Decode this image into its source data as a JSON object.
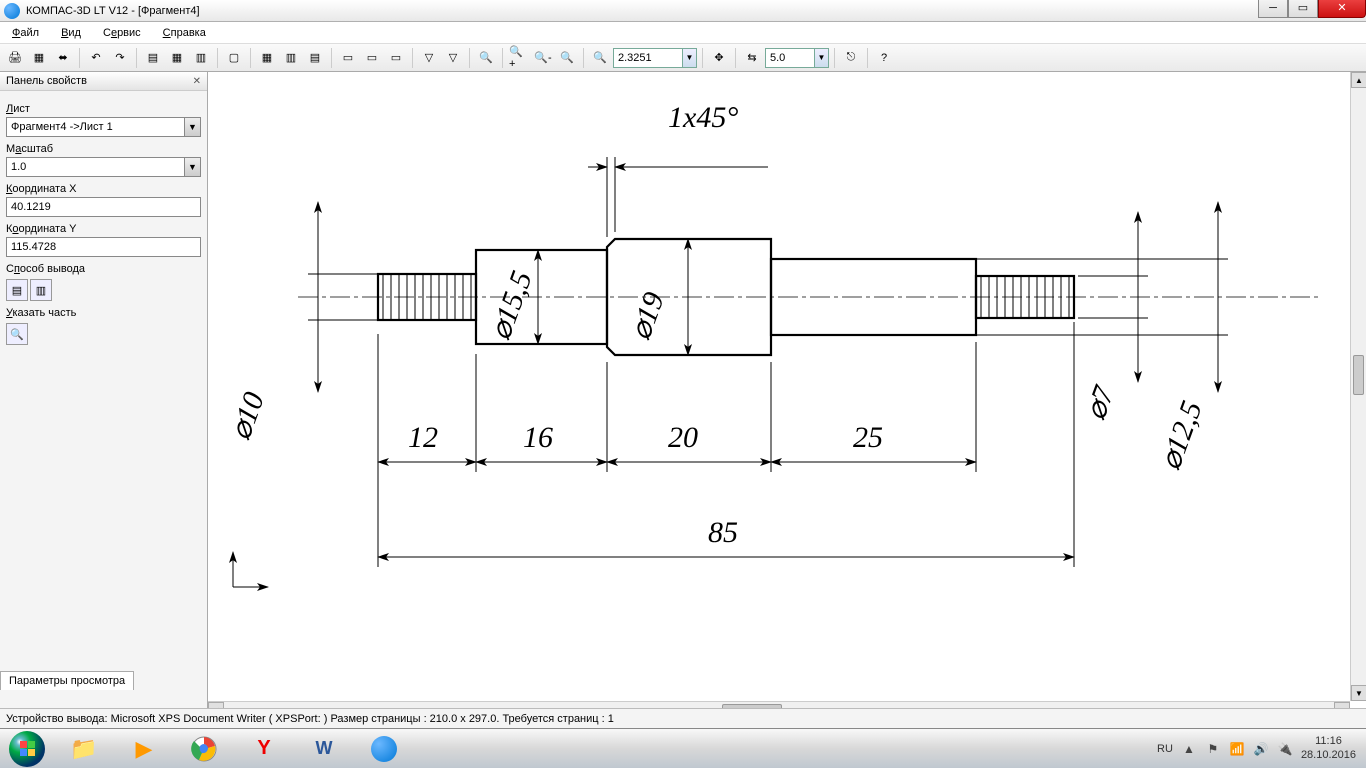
{
  "window": {
    "title": "КОМПАС-3D LT V12 - [Фрагмент4]"
  },
  "menu": {
    "file": "Файл",
    "view": "Вид",
    "service": "Сервис",
    "help": "Справка"
  },
  "toolbar": {
    "zoom_value": "2.3251",
    "step_value": "5.0"
  },
  "panel": {
    "title": "Панель свойств",
    "sheet_label": "Лист",
    "sheet_value": "Фрагмент4 ->Лист 1",
    "scale_label": "Масштаб",
    "scale_value": "1.0",
    "coordX_label": "Координата X",
    "coordX_value": "40.1219",
    "coordY_label": "Координата Y",
    "coordY_value": "115.4728",
    "output_label": "Способ вывода",
    "part_label": "Указать часть",
    "tab": "Параметры просмотра"
  },
  "statusbar": {
    "text": "Устройство вывода: Microsoft XPS Document Writer ( XPSPort: )   Размер страницы : 210.0 x 297.0.   Требуется страниц : 1"
  },
  "drawing": {
    "chamfer": "1x45°",
    "d10": "⌀10",
    "d155": "⌀15,5",
    "d19": "⌀19",
    "d7": "⌀7",
    "d125": "⌀12,5",
    "L12": "12",
    "L16": "16",
    "L20": "20",
    "L25": "25",
    "L85": "85"
  },
  "taskbar": {
    "lang": "RU",
    "time": "11:16",
    "date": "28.10.2016"
  }
}
